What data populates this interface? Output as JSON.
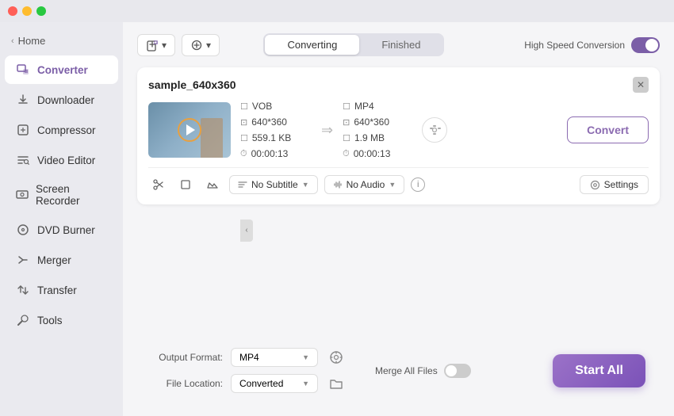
{
  "titlebar": {
    "buttons": [
      "close",
      "minimize",
      "maximize"
    ]
  },
  "sidebar": {
    "home_label": "Home",
    "items": [
      {
        "id": "converter",
        "label": "Converter",
        "icon": "⊞",
        "active": true
      },
      {
        "id": "downloader",
        "label": "Downloader",
        "icon": "↓"
      },
      {
        "id": "compressor",
        "label": "Compressor",
        "icon": "⊡"
      },
      {
        "id": "video-editor",
        "label": "Video Editor",
        "icon": "✂"
      },
      {
        "id": "screen-recorder",
        "label": "Screen Recorder",
        "icon": "⏺"
      },
      {
        "id": "dvd-burner",
        "label": "DVD Burner",
        "icon": "💿"
      },
      {
        "id": "merger",
        "label": "Merger",
        "icon": "⊕"
      },
      {
        "id": "transfer",
        "label": "Transfer",
        "icon": "⇄"
      },
      {
        "id": "tools",
        "label": "Tools",
        "icon": "🔧"
      }
    ]
  },
  "tabs": {
    "converting_label": "Converting",
    "finished_label": "Finished",
    "active": "converting"
  },
  "top_bar": {
    "add_files_label": "Add Files",
    "add_more_label": "Add More",
    "high_speed_label": "High Speed Conversion",
    "toggle_on": true
  },
  "file_card": {
    "file_name": "sample_640x360",
    "source": {
      "format": "VOB",
      "resolution": "640*360",
      "file_size": "559.1 KB",
      "duration": "00:00:13"
    },
    "output": {
      "format": "MP4",
      "resolution": "640*360",
      "file_size": "1.9 MB",
      "duration": "00:00:13"
    },
    "convert_btn_label": "Convert"
  },
  "toolbar": {
    "subtitle_label": "No Subtitle",
    "audio_label": "No Audio",
    "settings_label": "Settings"
  },
  "bottom_bar": {
    "output_format_label": "Output Format:",
    "output_format_value": "MP4",
    "file_location_label": "File Location:",
    "file_location_value": "Converted",
    "merge_label": "Merge All Files",
    "start_all_label": "Start All"
  }
}
